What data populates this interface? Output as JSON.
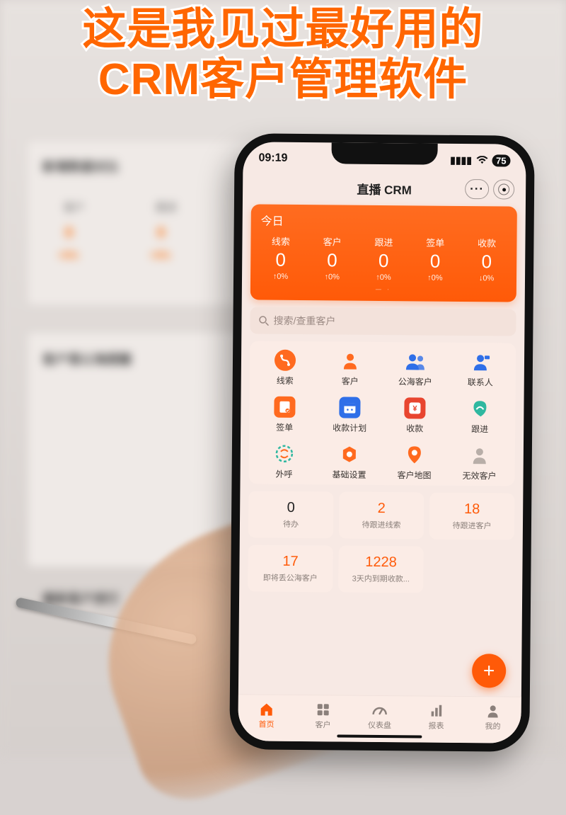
{
  "caption": {
    "line1": "这是我见过最好用的",
    "line2": "CRM客户管理软件"
  },
  "backdrop": {
    "section1_title": "新增数据对比",
    "col1": "客户",
    "col2": "跟进",
    "val": "0",
    "delta": "+0%",
    "section2_title": "客户落公海提醒",
    "section3_title": "最新客户排行"
  },
  "status": {
    "time": "09:19",
    "battery": "75"
  },
  "title": "直播 CRM",
  "today": {
    "label": "今日",
    "stats": [
      {
        "h": "线索",
        "v": "0",
        "d": "↑0%"
      },
      {
        "h": "客户",
        "v": "0",
        "d": "↑0%"
      },
      {
        "h": "跟进",
        "v": "0",
        "d": "↑0%"
      },
      {
        "h": "签单",
        "v": "0",
        "d": "↑0%"
      },
      {
        "h": "收款",
        "v": "0",
        "d": "↓0%"
      }
    ]
  },
  "search": {
    "placeholder": "搜索/查重客户"
  },
  "menu": [
    {
      "label": "线索"
    },
    {
      "label": "客户"
    },
    {
      "label": "公海客户"
    },
    {
      "label": "联系人"
    },
    {
      "label": "签单"
    },
    {
      "label": "收款计划"
    },
    {
      "label": "收款"
    },
    {
      "label": "跟进"
    },
    {
      "label": "外呼"
    },
    {
      "label": "基础设置"
    },
    {
      "label": "客户地图"
    },
    {
      "label": "无效客户"
    }
  ],
  "tiles": [
    {
      "n": "0",
      "l": "待办",
      "hot": false
    },
    {
      "n": "2",
      "l": "待跟进线索",
      "hot": true
    },
    {
      "n": "18",
      "l": "待跟进客户",
      "hot": true
    },
    {
      "n": "17",
      "l": "即将丢公海客户",
      "hot": true
    },
    {
      "n": "1228",
      "l": "3天内到期收款...",
      "hot": true
    }
  ],
  "tabs": [
    {
      "l": "首页"
    },
    {
      "l": "客户"
    },
    {
      "l": "仪表盘"
    },
    {
      "l": "报表"
    },
    {
      "l": "我的"
    }
  ]
}
